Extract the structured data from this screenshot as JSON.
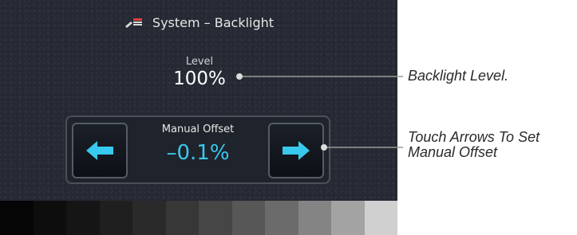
{
  "screen": {
    "title": "System – Backlight",
    "title_icon": "wrench-settings-icon",
    "level": {
      "label": "Level",
      "value": "100%"
    },
    "manual_offset": {
      "label": "Manual Offset",
      "value": "–0.1%",
      "decrease_icon": "arrow-left-icon",
      "increase_icon": "arrow-right-icon"
    },
    "gray_scale": [
      "#050505",
      "#0d0d0d",
      "#151515",
      "#1f1f1f",
      "#2a2a2a",
      "#373737",
      "#464646",
      "#575757",
      "#6b6b6b",
      "#848484",
      "#a3a3a3",
      "#d0d0d0"
    ]
  },
  "callouts": {
    "level": "Backlight Level.",
    "offset_line1": "Touch Arrows To Set",
    "offset_line2": "Manual Offset"
  },
  "colors": {
    "accent": "#38c9ee",
    "screen_bg": "#252933"
  }
}
